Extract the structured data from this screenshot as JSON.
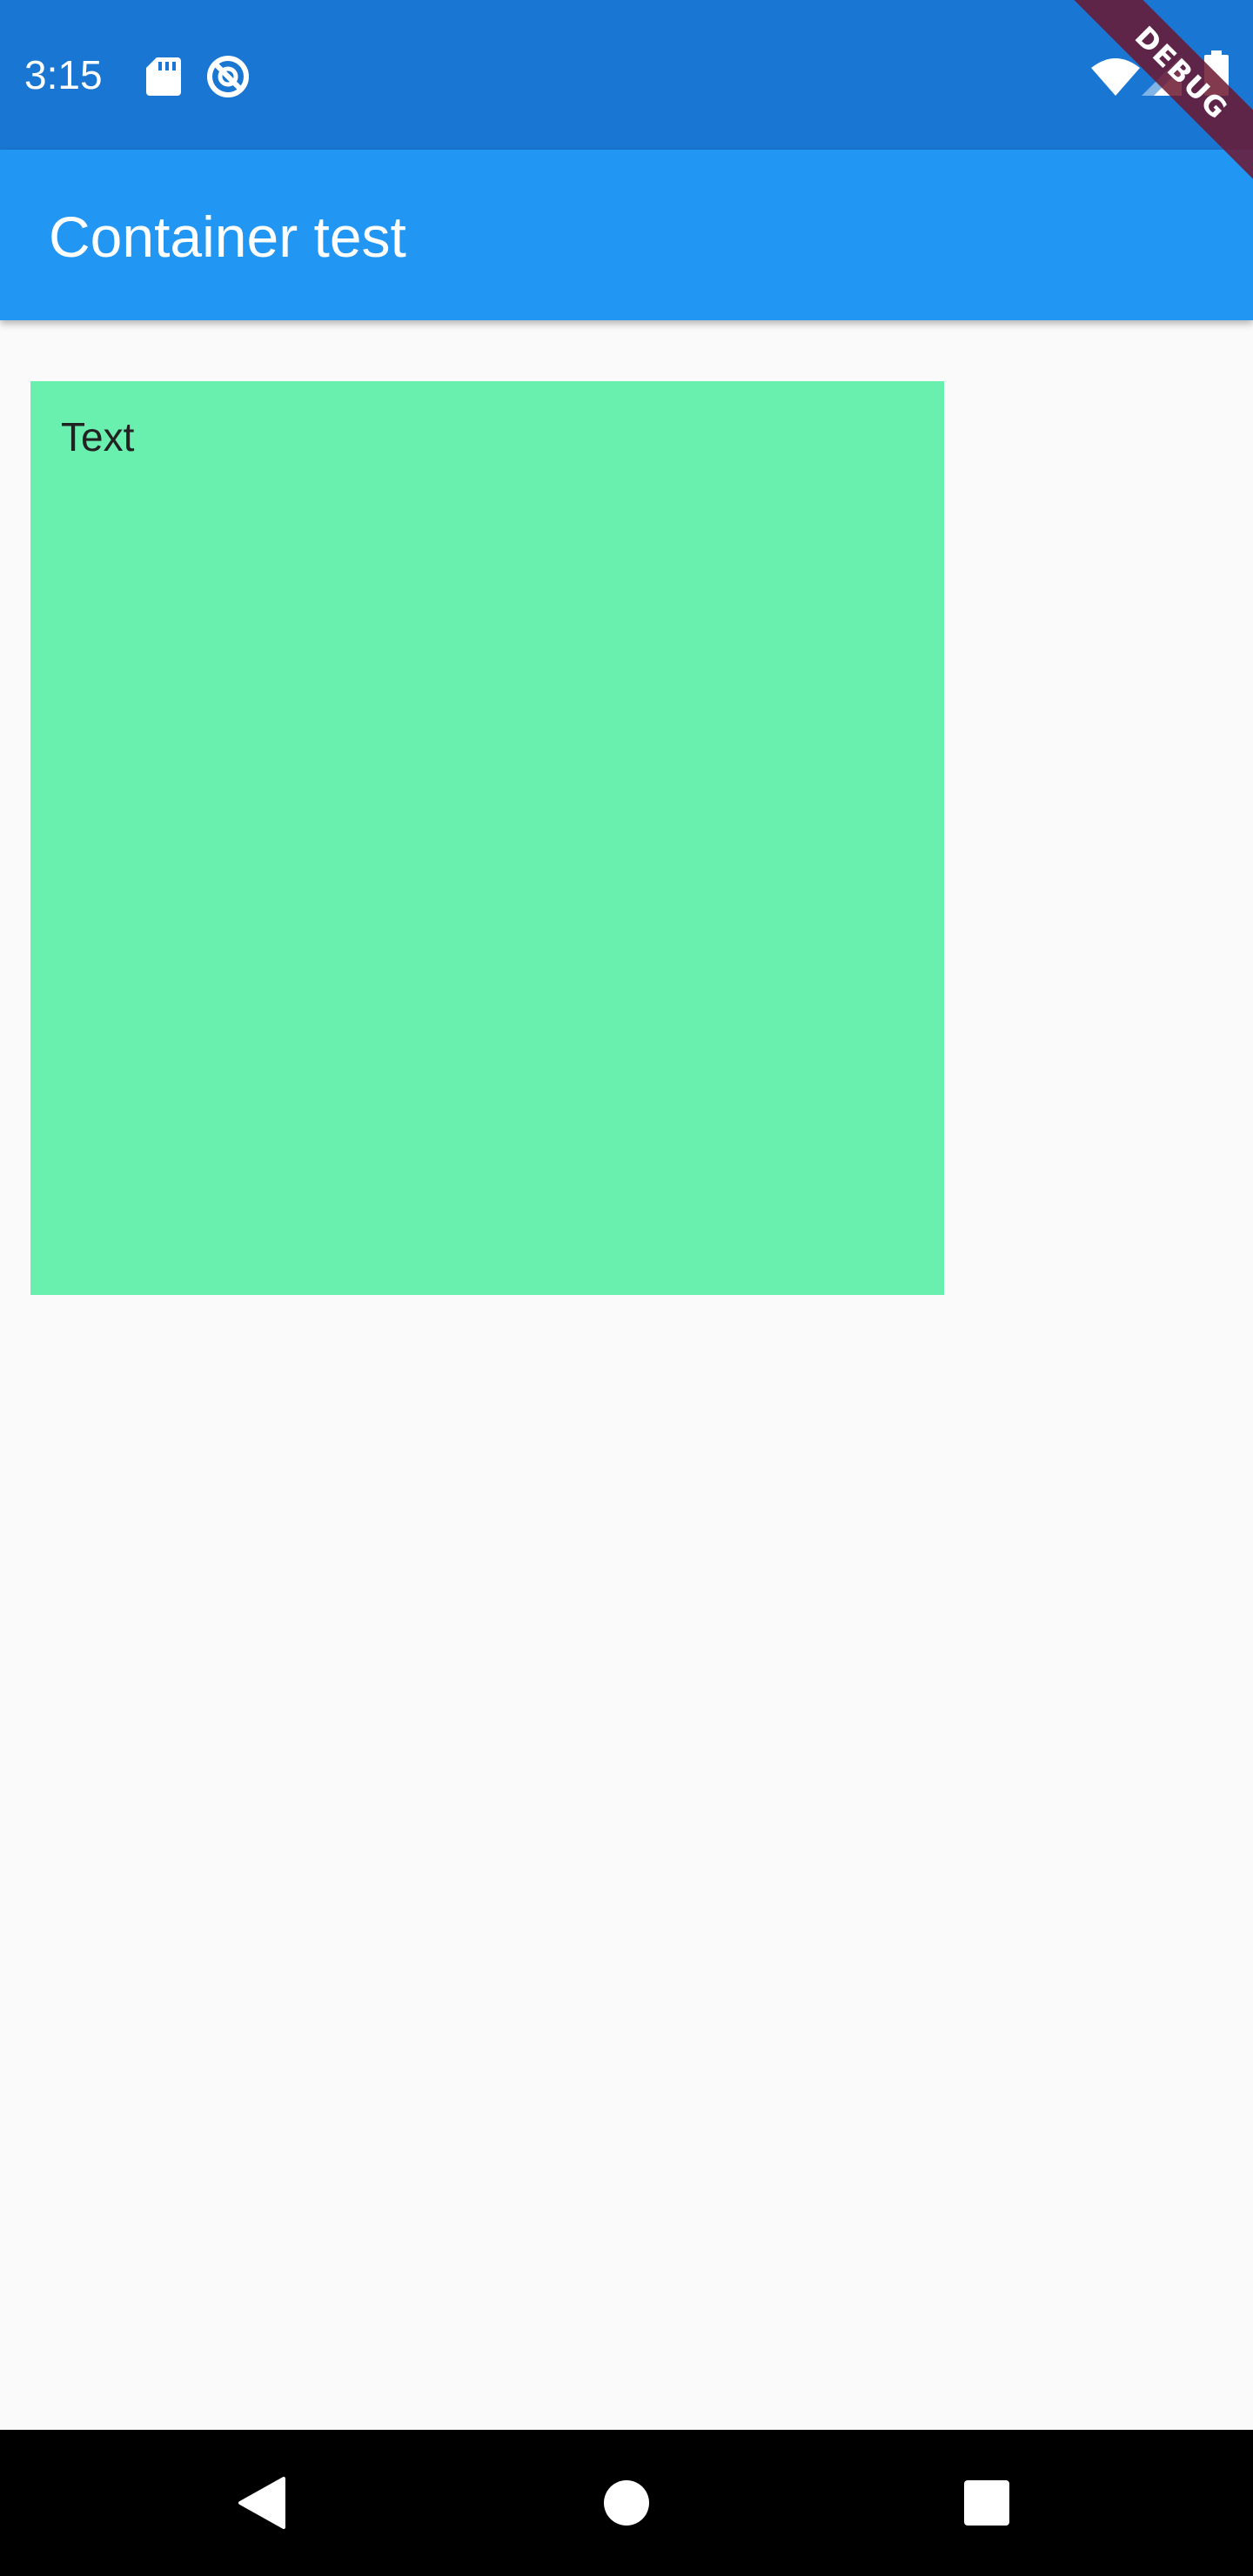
{
  "status_bar": {
    "time": "3:15",
    "background_color": "#1976d2",
    "icons": [
      "sd-card-icon",
      "sync-off-icon",
      "wifi-icon",
      "cell-signal-icon",
      "battery-icon"
    ]
  },
  "debug_banner": {
    "label": "DEBUG",
    "color": "#6c1830"
  },
  "app_bar": {
    "title": "Container test",
    "background_color": "#2196f3"
  },
  "body": {
    "container": {
      "text": "Text",
      "background_color": "#69f0ae"
    }
  },
  "nav_bar": {
    "buttons": [
      "back-icon",
      "home-icon",
      "recents-icon"
    ]
  }
}
